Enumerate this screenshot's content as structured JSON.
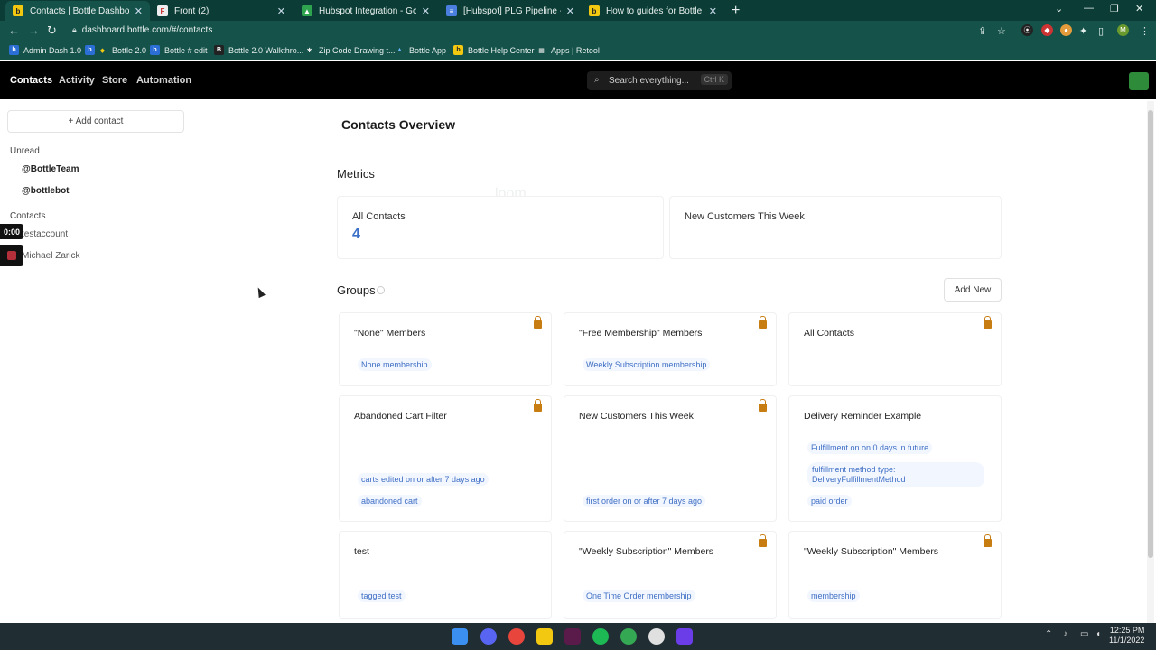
{
  "browser": {
    "tabs": [
      {
        "title": "Contacts | Bottle Dashboard",
        "active": true
      },
      {
        "title": "Front (2)",
        "active": false
      },
      {
        "title": "Hubspot Integration - Google Dr",
        "active": false
      },
      {
        "title": "[Hubspot] PLG Pipeline - Google",
        "active": false
      },
      {
        "title": "How to guides for Bottle - Bottle",
        "active": false
      }
    ],
    "url": "dashboard.bottle.com/#/contacts",
    "bookmarks": [
      "Admin Dash 1.0",
      "Bottle 2.0",
      "Bottle # edit",
      "Bottle 2.0 Walkthro...",
      "Zip Code Drawing t...",
      "Bottle App",
      "Bottle Help Center",
      "Apps | Retool"
    ]
  },
  "app": {
    "nav": [
      "Contacts",
      "Activity",
      "Store",
      "Automation"
    ],
    "search_placeholder": "Search everything...",
    "search_shortcut": "Ctrl K"
  },
  "sidebar": {
    "add_contact": "+ Add contact",
    "unread_heading": "Unread",
    "unread_items": [
      "@BottleTeam",
      "@bottlebot"
    ],
    "contacts_heading": "Contacts",
    "contacts": [
      "testaccount",
      "Michael Zarick"
    ]
  },
  "recorder": {
    "timer": "0:00"
  },
  "main": {
    "title": "Contacts Overview",
    "metrics_heading": "Metrics",
    "metrics": [
      {
        "label": "All Contacts",
        "value": "4"
      },
      {
        "label": "New Customers This Week",
        "value": ""
      }
    ],
    "groups_heading": "Groups",
    "add_new": "Add New",
    "groups": [
      {
        "title": "\"None\" Members",
        "locked": true,
        "tags": [
          "None membership"
        ]
      },
      {
        "title": "\"Free Membership\" Members",
        "locked": true,
        "tags": [
          "Weekly Subscription membership"
        ]
      },
      {
        "title": "All Contacts",
        "locked": true,
        "tags": []
      },
      {
        "title": "Abandoned Cart Filter",
        "locked": true,
        "tags": [
          "carts edited on or after 7 days ago",
          "abandoned cart"
        ]
      },
      {
        "title": "New Customers This Week",
        "locked": true,
        "tags": [
          "first order on or after 7 days ago"
        ]
      },
      {
        "title": "Delivery Reminder Example",
        "locked": false,
        "tags": [
          "Fulfillment on on 0 days in future",
          "fulfillment method type: DeliveryFulfillmentMethod",
          "paid order"
        ]
      },
      {
        "title": "test",
        "locked": false,
        "tags": [
          "tagged test"
        ]
      },
      {
        "title": "\"Weekly Subscription\" Members",
        "locked": true,
        "tags": [
          "One Time Order membership"
        ]
      },
      {
        "title": "\"Weekly Subscription\" Members",
        "locked": true,
        "tags": [
          "membership"
        ]
      }
    ]
  },
  "taskbar": {
    "time": "12:25 PM",
    "date": "11/1/2022"
  },
  "colors": {
    "chrome_dark": "#0b3d36",
    "chrome_mid": "#14524a",
    "app_header": "#000000",
    "metric_value": "#3a6fc7",
    "tag_text": "#3f6ec4",
    "lock": "#c87d12"
  }
}
